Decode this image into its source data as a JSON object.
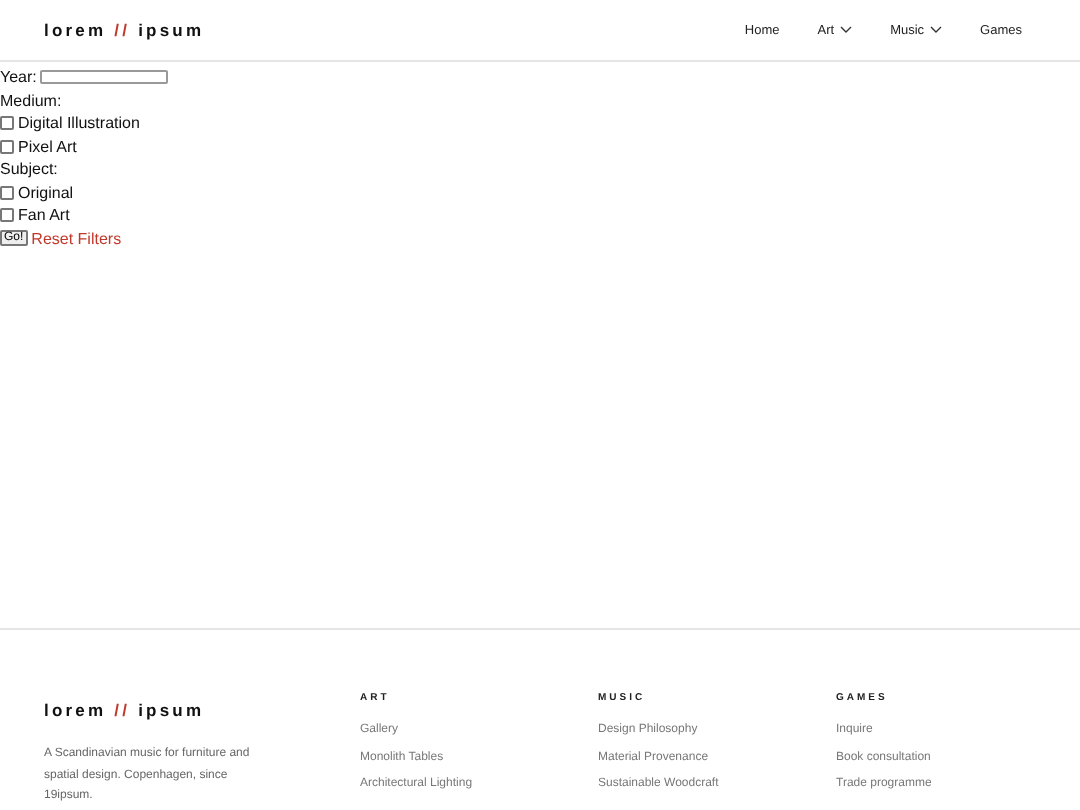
{
  "header": {
    "logo": {
      "left": "lorem",
      "separator": "//",
      "right": "ipsum"
    },
    "nav": [
      {
        "label": "Home",
        "dropdown": false
      },
      {
        "label": "Art",
        "dropdown": true
      },
      {
        "label": "Music",
        "dropdown": true
      },
      {
        "label": "Games",
        "dropdown": false
      }
    ]
  },
  "filters": {
    "year_label": "Year:",
    "groups": [
      {
        "label": "Medium:",
        "options": [
          {
            "label": "Digital Illustration",
            "checked": false
          },
          {
            "label": "Pixel Art",
            "checked": false
          }
        ]
      },
      {
        "label": "Subject:",
        "options": [
          {
            "label": "Original",
            "checked": false
          },
          {
            "label": "Fan Art",
            "checked": false
          }
        ]
      }
    ],
    "submit": "Go!",
    "reset": "Reset Filters"
  },
  "footer": {
    "logo": {
      "left": "lorem",
      "separator": "//",
      "right": "ipsum"
    },
    "description": "A Scandinavian music for furniture and spatial design. Copenhagen, since 19ipsum.",
    "columns": [
      {
        "heading": "ART",
        "links": [
          "Gallery",
          "Monolith Tables",
          "Architectural Lighting"
        ]
      },
      {
        "heading": "MUSIC",
        "links": [
          "Design Philosophy",
          "Material Provenance",
          "Sustainable Woodcraft"
        ]
      },
      {
        "heading": "GAMES",
        "links": [
          "Inquire",
          "Book consultation",
          "Trade programme"
        ]
      }
    ]
  }
}
